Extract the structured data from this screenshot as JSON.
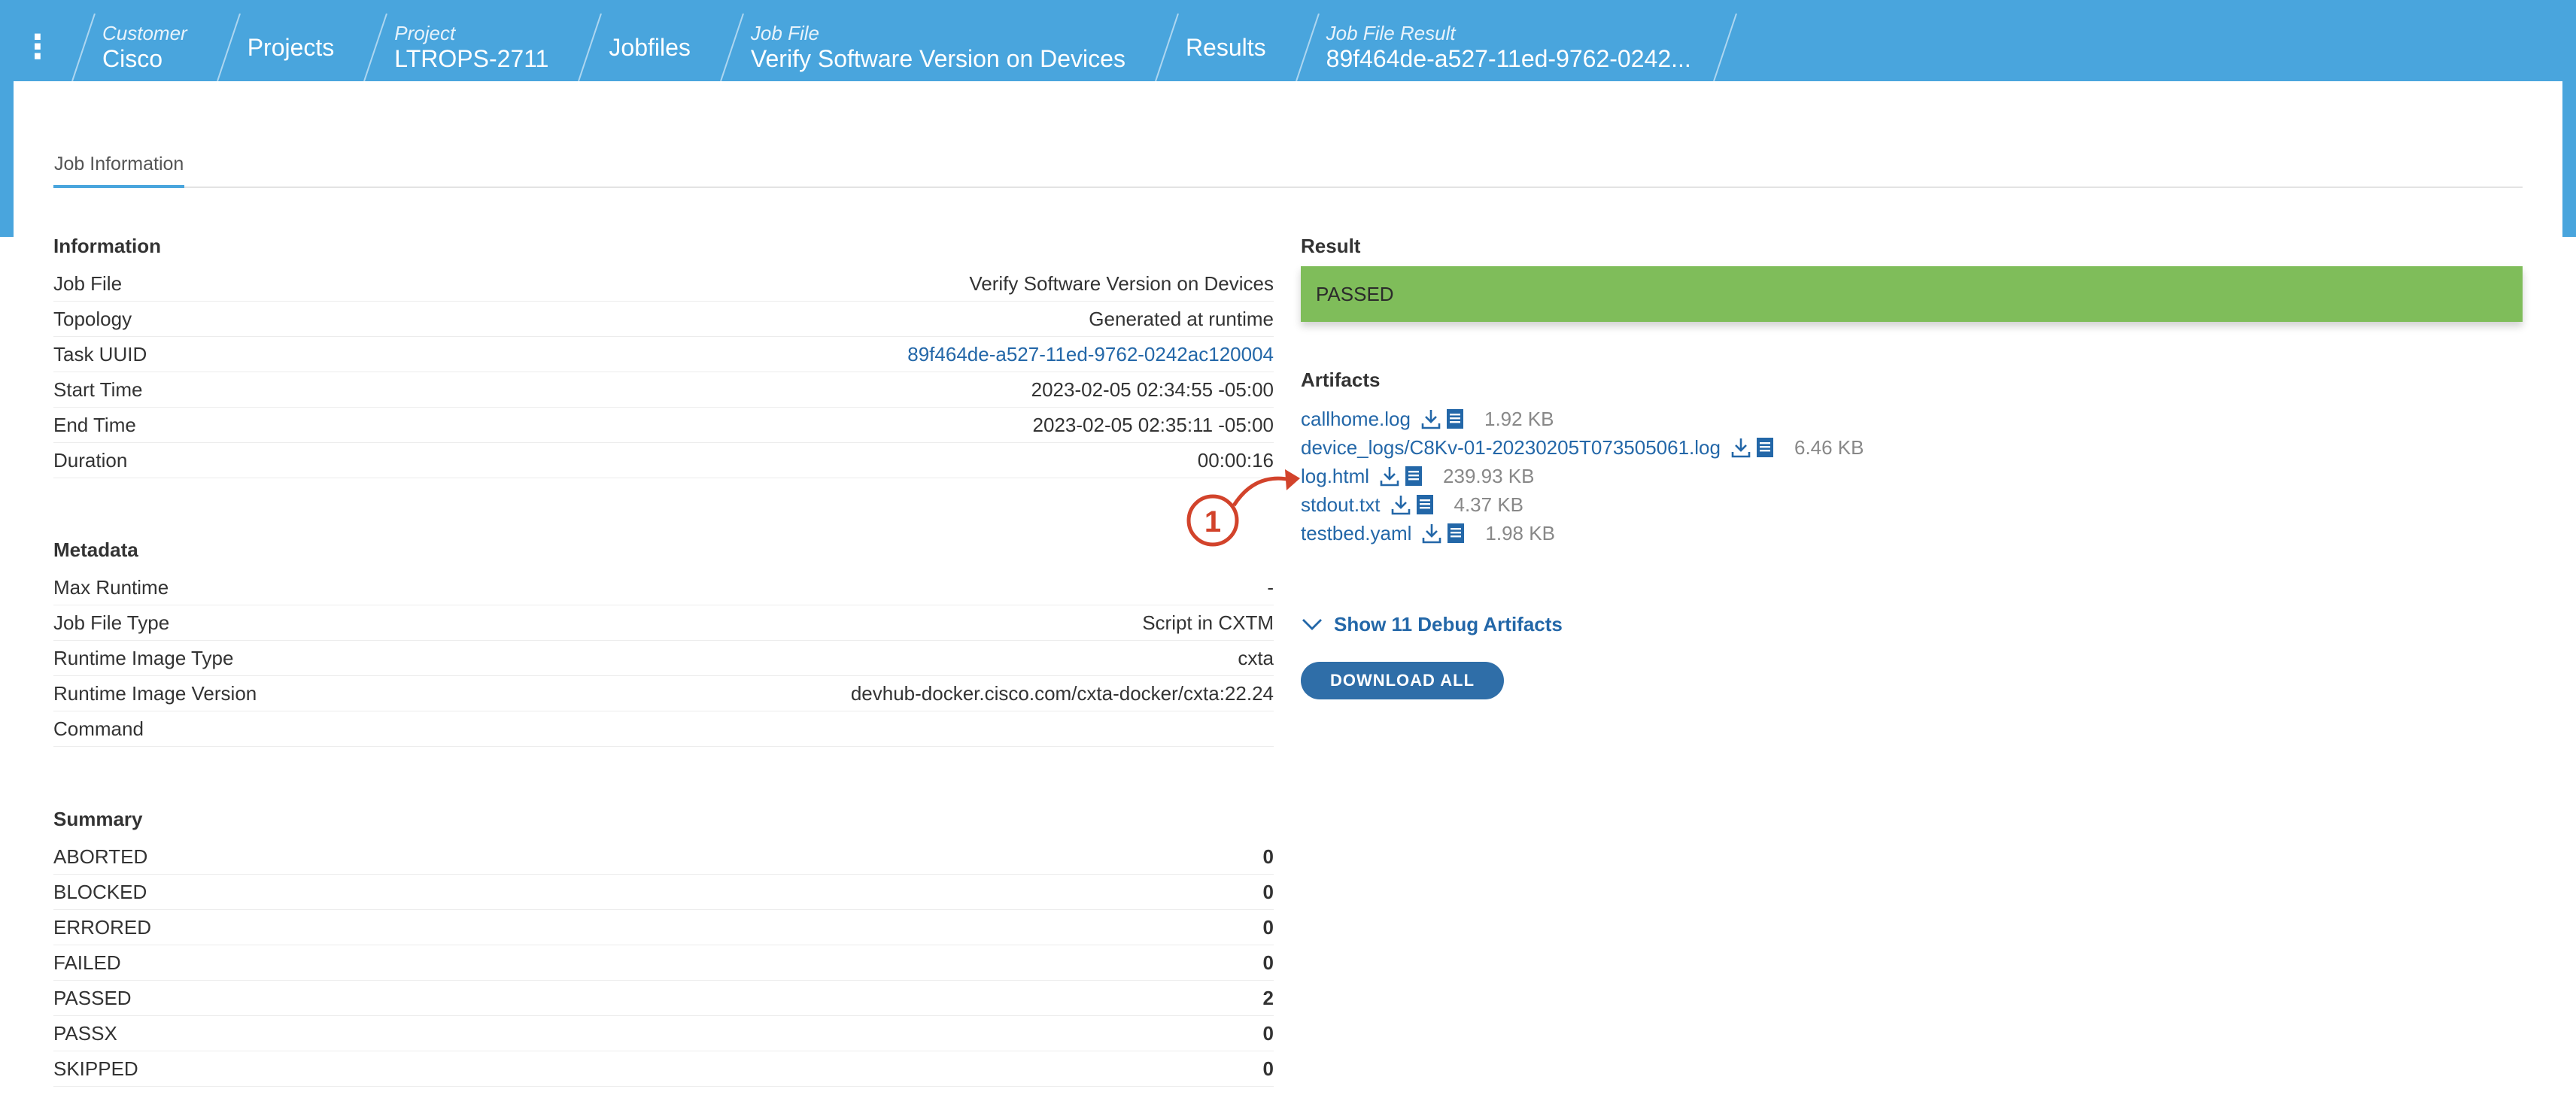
{
  "breadcrumbs": [
    {
      "sub": "Customer",
      "main": "Cisco"
    },
    {
      "sub": "",
      "main": "Projects"
    },
    {
      "sub": "Project",
      "main": "LTROPS-2711"
    },
    {
      "sub": "",
      "main": "Jobfiles"
    },
    {
      "sub": "Job File",
      "main": "Verify Software Version on Devices"
    },
    {
      "sub": "",
      "main": "Results"
    },
    {
      "sub": "Job File Result",
      "main": "89f464de-a527-11ed-9762-0242..."
    }
  ],
  "tabs": {
    "job_information": "Job Information"
  },
  "information": {
    "title": "Information",
    "rows": [
      {
        "label": "Job File",
        "value": "Verify Software Version on Devices"
      },
      {
        "label": "Topology",
        "value": "Generated at runtime"
      },
      {
        "label": "Task UUID",
        "value": "89f464de-a527-11ed-9762-0242ac120004"
      },
      {
        "label": "Start Time",
        "value": "2023-02-05 02:34:55 -05:00"
      },
      {
        "label": "End Time",
        "value": "2023-02-05 02:35:11 -05:00"
      },
      {
        "label": "Duration",
        "value": "00:00:16"
      }
    ]
  },
  "metadata": {
    "title": "Metadata",
    "rows": [
      {
        "label": "Max Runtime",
        "value": "-"
      },
      {
        "label": "Job File Type",
        "value": "Script in CXTM"
      },
      {
        "label": "Runtime Image Type",
        "value": "cxta"
      },
      {
        "label": "Runtime Image Version",
        "value": "devhub-docker.cisco.com/cxta-docker/cxta:22.24"
      },
      {
        "label": "Command",
        "value": ""
      }
    ]
  },
  "summary": {
    "title": "Summary",
    "rows": [
      {
        "label": "ABORTED",
        "value": "0"
      },
      {
        "label": "BLOCKED",
        "value": "0"
      },
      {
        "label": "ERRORED",
        "value": "0"
      },
      {
        "label": "FAILED",
        "value": "0"
      },
      {
        "label": "PASSED",
        "value": "2"
      },
      {
        "label": "PASSX",
        "value": "0"
      },
      {
        "label": "SKIPPED",
        "value": "0"
      }
    ]
  },
  "result": {
    "title": "Result",
    "status": "PASSED",
    "status_color": "#7fbd5a"
  },
  "artifacts": {
    "title": "Artifacts",
    "items": [
      {
        "name": "callhome.log",
        "size": "1.92 KB"
      },
      {
        "name": "device_logs/C8Kv-01-20230205T073505061.log",
        "size": "6.46 KB"
      },
      {
        "name": "log.html",
        "size": "239.93 KB"
      },
      {
        "name": "stdout.txt",
        "size": "4.37 KB"
      },
      {
        "name": "testbed.yaml",
        "size": "1.98 KB"
      }
    ]
  },
  "debug_toggle": {
    "label": "Show 11 Debug Artifacts",
    "icon": "chevron-down-icon"
  },
  "download_all": {
    "label": "DOWNLOAD ALL"
  },
  "annotation": {
    "number": "1",
    "color": "#d2432b"
  },
  "colors": {
    "header": "#49a5dd",
    "link": "#2367a8",
    "button": "#2f6ea8"
  }
}
